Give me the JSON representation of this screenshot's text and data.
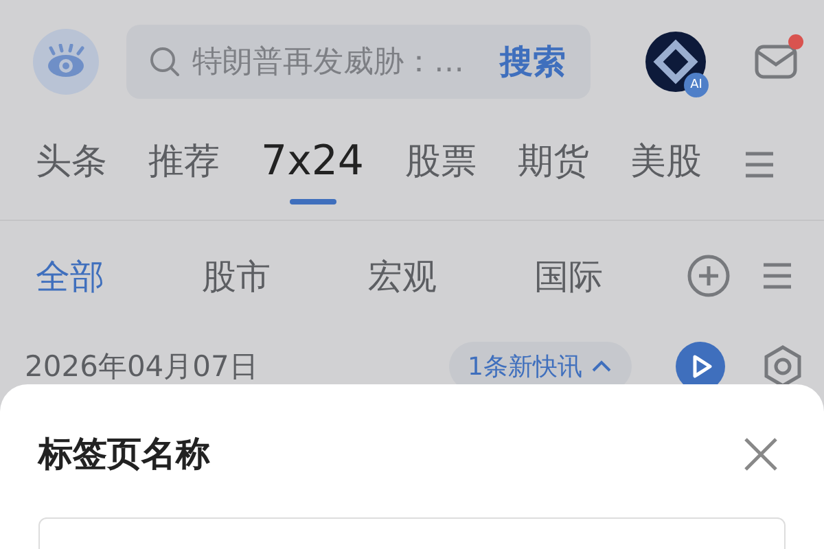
{
  "search": {
    "placeholder": "特朗普再发威胁：…",
    "button": "搜索"
  },
  "avatar": {
    "badge": "AI"
  },
  "mail": {
    "unread": true
  },
  "tabs": [
    {
      "label": "头条",
      "selected": false
    },
    {
      "label": "推荐",
      "selected": false
    },
    {
      "label": "7x24",
      "selected": true
    },
    {
      "label": "股票",
      "selected": false
    },
    {
      "label": "期货",
      "selected": false
    },
    {
      "label": "美股",
      "selected": false
    }
  ],
  "subtabs": [
    {
      "label": "全部",
      "selected": true
    },
    {
      "label": "股市",
      "selected": false
    },
    {
      "label": "宏观",
      "selected": false
    },
    {
      "label": "国际",
      "selected": false
    }
  ],
  "date": "2026年04月07日",
  "new_items": "1条新快讯",
  "sheet": {
    "title": "标签页名称"
  }
}
